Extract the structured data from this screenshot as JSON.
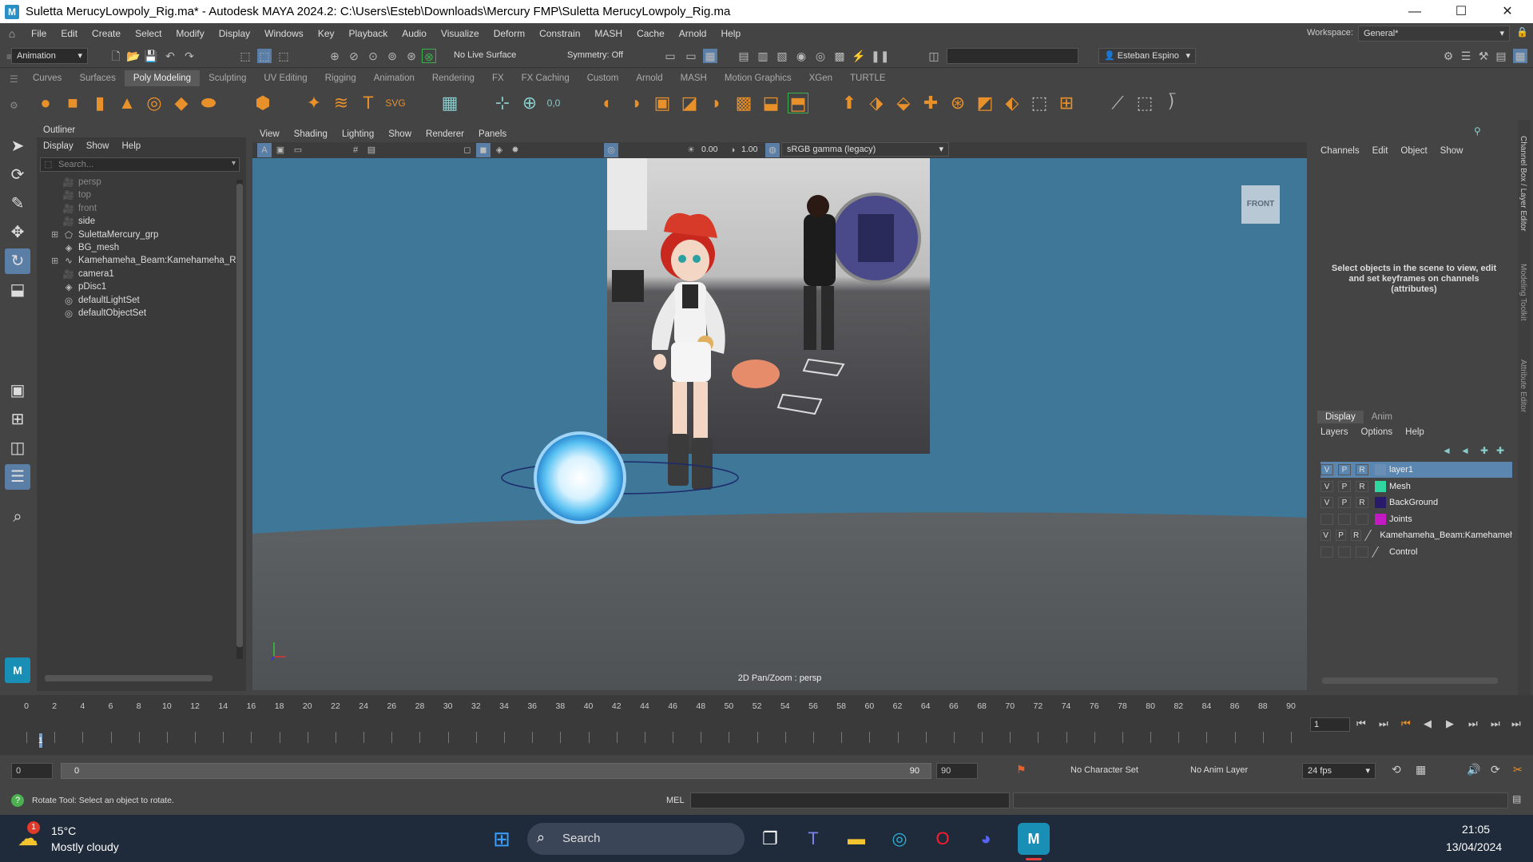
{
  "window": {
    "title": "Suletta MerucyLowpoly_Rig.ma* - Autodesk MAYA 2024.2: C:\\Users\\Esteb\\Downloads\\Mercury FMP\\Suletta MerucyLowpoly_Rig.ma",
    "logo_text": "M",
    "minimize": "—",
    "maximize": "☐",
    "close": "✕"
  },
  "menubar": {
    "items": [
      "File",
      "Edit",
      "Create",
      "Select",
      "Modify",
      "Display",
      "Windows",
      "Key",
      "Playback",
      "Audio",
      "Visualize",
      "Deform",
      "Constrain",
      "MASH",
      "Cache",
      "Arnold",
      "Help"
    ],
    "workspace_label": "Workspace:",
    "workspace_value": "General*"
  },
  "statusline": {
    "mode": "Animation",
    "live_surface": "No Live Surface",
    "symmetry": "Symmetry: Off",
    "user": "Esteban Espino"
  },
  "shelf": {
    "tabs": [
      "Curves",
      "Surfaces",
      "Poly Modeling",
      "Sculpting",
      "UV Editing",
      "Rigging",
      "Animation",
      "Rendering",
      "FX",
      "FX Caching",
      "Custom",
      "Arnold",
      "MASH",
      "Motion Graphics",
      "XGen",
      "TURTLE"
    ],
    "active": "Poly Modeling"
  },
  "outliner": {
    "title": "Outliner",
    "menu": [
      "Display",
      "Show",
      "Help"
    ],
    "search_placeholder": "Search...",
    "items": [
      {
        "label": "persp",
        "icon": "camera-icon",
        "dim": true,
        "expand": ""
      },
      {
        "label": "top",
        "icon": "camera-icon",
        "dim": true,
        "expand": ""
      },
      {
        "label": "front",
        "icon": "camera-icon",
        "dim": true,
        "expand": ""
      },
      {
        "label": "side",
        "icon": "camera-icon",
        "dim": false,
        "expand": ""
      },
      {
        "label": "SulettaMercury_grp",
        "icon": "group-icon",
        "dim": false,
        "expand": "⊞"
      },
      {
        "label": "BG_mesh",
        "icon": "mesh-icon",
        "dim": false,
        "expand": ""
      },
      {
        "label": "Kamehameha_Beam:Kamehameha_Rig",
        "icon": "curve-icon",
        "dim": false,
        "expand": "⊞"
      },
      {
        "label": "camera1",
        "icon": "camera-icon",
        "dim": false,
        "expand": ""
      },
      {
        "label": "pDisc1",
        "icon": "mesh-icon",
        "dim": false,
        "expand": ""
      },
      {
        "label": "defaultLightSet",
        "icon": "set-icon",
        "dim": false,
        "expand": ""
      },
      {
        "label": "defaultObjectSet",
        "icon": "set-icon",
        "dim": false,
        "expand": ""
      }
    ]
  },
  "viewport": {
    "menu": [
      "View",
      "Shading",
      "Lighting",
      "Show",
      "Renderer",
      "Panels"
    ],
    "field1": "0.00",
    "field2": "1.00",
    "colorspace": "sRGB gamma (legacy)",
    "cube_label": "FRONT",
    "hud_label": "2D Pan/Zoom : persp"
  },
  "channelbox": {
    "menu": [
      "Channels",
      "Edit",
      "Object",
      "Show"
    ],
    "message": "Select objects in the scene to view, edit and set keyframes on channels (attributes)",
    "side_tabs": [
      "Channel Box / Layer Editor",
      "Modeling Toolkit",
      "Attribute Editor"
    ]
  },
  "layers": {
    "tabs": [
      "Display",
      "Anim"
    ],
    "menu": [
      "Layers",
      "Options",
      "Help"
    ],
    "rows": [
      {
        "v": "V",
        "p": "P",
        "r": "R",
        "name": "layer1",
        "color": "#6a8fb4",
        "selected": true
      },
      {
        "v": "V",
        "p": "P",
        "r": "R",
        "name": "Mesh",
        "color": "#2fd6a0",
        "selected": false
      },
      {
        "v": "V",
        "p": "P",
        "r": "R",
        "name": "BackGround",
        "color": "#2a1a6a",
        "selected": false
      },
      {
        "v": "",
        "p": "",
        "r": "",
        "name": "Joints",
        "color": "#c41ac4",
        "selected": false
      },
      {
        "v": "V",
        "p": "P",
        "r": "R",
        "name": "Kamehameha_Beam:Kamehameha_Beam",
        "color": "",
        "selected": false
      },
      {
        "v": "",
        "p": "",
        "r": "",
        "name": "Control",
        "color": "",
        "selected": false
      }
    ]
  },
  "timeline": {
    "ticks": [
      "0",
      "2",
      "4",
      "6",
      "8",
      "10",
      "12",
      "14",
      "16",
      "18",
      "20",
      "22",
      "24",
      "26",
      "28",
      "30",
      "32",
      "34",
      "36",
      "38",
      "40",
      "42",
      "44",
      "46",
      "48",
      "50",
      "52",
      "54",
      "56",
      "58",
      "60",
      "62",
      "64",
      "66",
      "68",
      "70",
      "72",
      "74",
      "76",
      "78",
      "80",
      "82",
      "84",
      "86",
      "88",
      "90"
    ],
    "current_frame_marker": "1",
    "current_frame": "1",
    "range_start": "0",
    "range_inner_start": "0",
    "range_inner_end": "90",
    "range_end": "90",
    "character_set": "No Character Set",
    "anim_layer": "No Anim Layer",
    "fps": "24 fps"
  },
  "helpline": {
    "message": "Rotate Tool: Select an object to rotate.",
    "mel_label": "MEL"
  },
  "taskbar": {
    "temperature": "15°C",
    "weather": "Mostly cloudy",
    "weather_badge": "1",
    "search_label": "Search",
    "time": "21:05",
    "date": "13/04/2024"
  }
}
